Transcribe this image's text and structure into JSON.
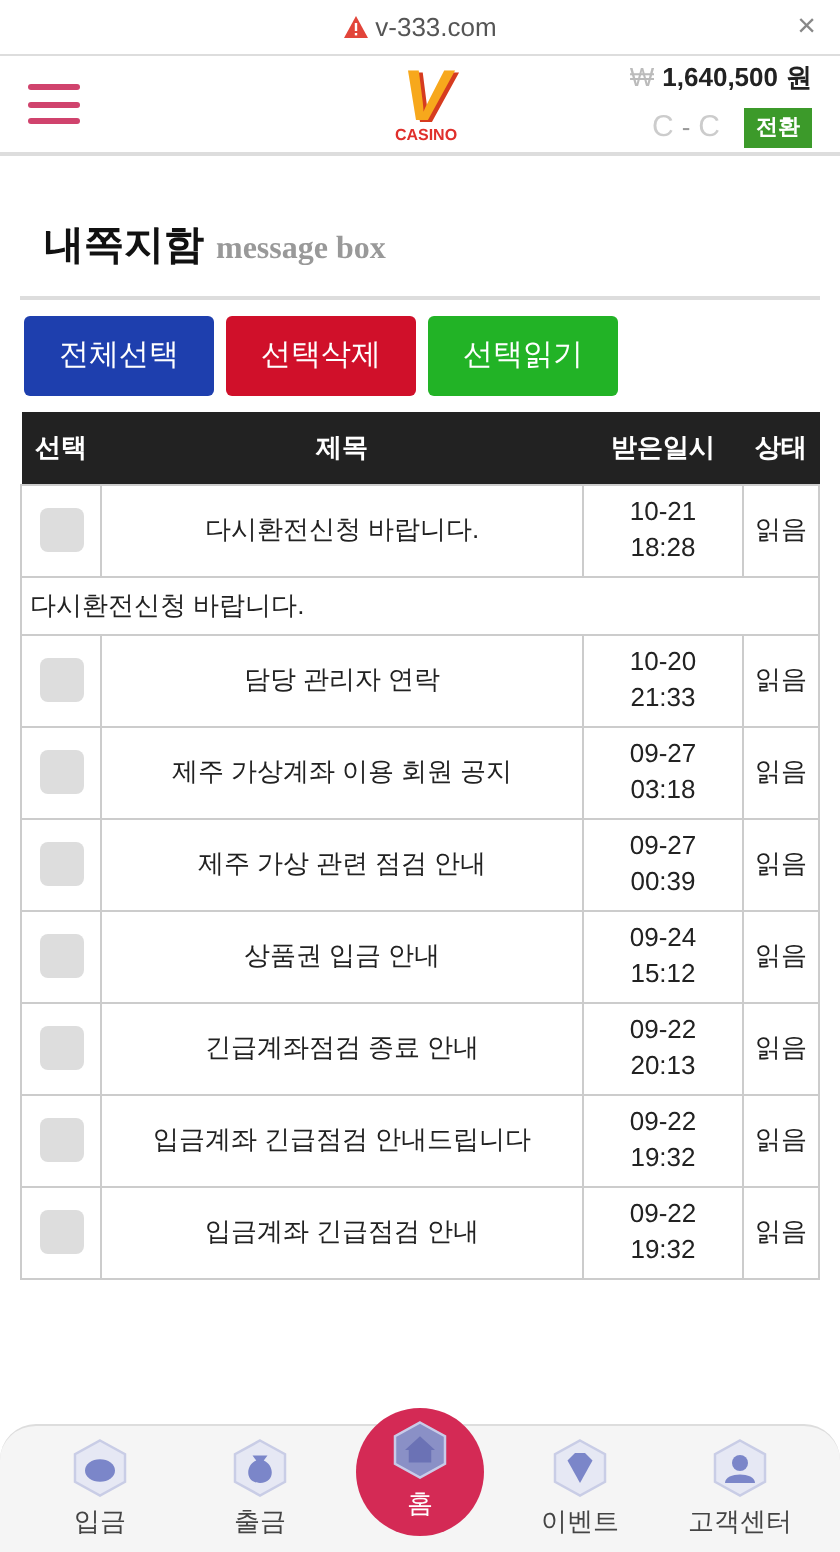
{
  "browser": {
    "url": "v-333.com",
    "close": "×"
  },
  "header": {
    "logo": {
      "letter": "V",
      "caption": "CASINO"
    },
    "currency": "₩",
    "balance": "1,640,500",
    "unit": "원",
    "refresh_a": "C",
    "dash": "-",
    "refresh_b": "C",
    "switch_button": "전환"
  },
  "page_title": {
    "title": "내쪽지함",
    "subtitle": "message box"
  },
  "actions": [
    {
      "label": "전체선택",
      "color": "#1e3fae"
    },
    {
      "label": "선택삭제",
      "color": "#d0102a"
    },
    {
      "label": "선택읽기",
      "color": "#22b326"
    }
  ],
  "table": {
    "columns": [
      "선택",
      "제목",
      "받은일시",
      "상태"
    ],
    "rows": [
      {
        "checked": false,
        "title": "다시환전신청 바랍니다.",
        "date": "10-21",
        "time": "18:28",
        "status": "읽음",
        "expanded": true,
        "body": "다시환전신청 바랍니다."
      },
      {
        "checked": false,
        "title": "담당 관리자 연락",
        "date": "10-20",
        "time": "21:33",
        "status": "읽음",
        "expanded": false
      },
      {
        "checked": false,
        "title": "제주 가상계좌 이용 회원 공지",
        "date": "09-27",
        "time": "03:18",
        "status": "읽음",
        "expanded": false
      },
      {
        "checked": false,
        "title": "제주 가상 관련 점검 안내",
        "date": "09-27",
        "time": "00:39",
        "status": "읽음",
        "expanded": false
      },
      {
        "checked": false,
        "title": "상품권 입금 안내",
        "date": "09-24",
        "time": "15:12",
        "status": "읽음",
        "expanded": false
      },
      {
        "checked": false,
        "title": "긴급계좌점검 종료 안내",
        "date": "09-22",
        "time": "20:13",
        "status": "읽음",
        "expanded": false
      },
      {
        "checked": false,
        "title": "입금계좌 긴급점검 안내드립니다",
        "date": "09-22",
        "time": "19:32",
        "status": "읽음",
        "expanded": false
      },
      {
        "checked": false,
        "title": "입금계좌 긴급점검 안내",
        "date": "09-22",
        "time": "19:32",
        "status": "읽음",
        "expanded": false
      }
    ]
  },
  "bottom_nav": [
    {
      "label": "입금",
      "kind": "piggy",
      "selected": false
    },
    {
      "label": "출금",
      "kind": "bag",
      "selected": false
    },
    {
      "label": "홈",
      "kind": "home",
      "selected": true
    },
    {
      "label": "이벤트",
      "kind": "gem",
      "selected": false
    },
    {
      "label": "고객센터",
      "kind": "agent",
      "selected": false
    }
  ]
}
